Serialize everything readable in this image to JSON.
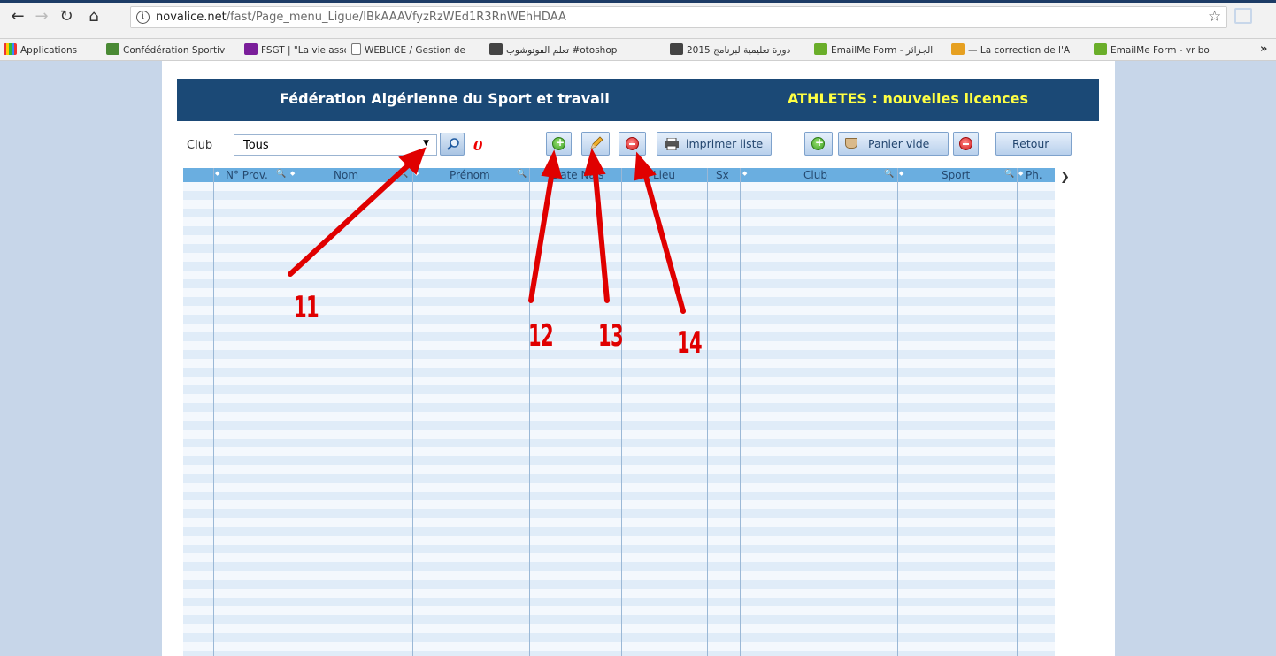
{
  "browser": {
    "url_main": "novalice.net",
    "url_path": "/fast/Page_menu_Ligue/IBkAAAVfyzRzWEd1R3RnWEhHDAA",
    "bookmarks": [
      "Applications",
      "Confédération Sportiv",
      "FSGT | \"La vie associat",
      "WEBLICE / Gestion de",
      "تعلم الفوتوشوب #otoshop",
      "دورة تعليمية لبرنامج 2015",
      "EmailMe Form - الجزائر",
      "— La correction de l'A",
      "EmailMe Form - vr bo"
    ],
    "more": "»"
  },
  "header": {
    "title": "Fédération Algérienne du Sport et travail",
    "subtitle": "ATHLETES : nouvelles licences"
  },
  "filter": {
    "club_label": "Club",
    "club_value": "Tous",
    "count": "0"
  },
  "toolbar": {
    "print_label": "imprimer liste",
    "basket_label": "Panier vide",
    "back_label": "Retour"
  },
  "grid": {
    "columns": [
      "N° Prov.",
      "Nom",
      "Prénom",
      "Date Nais",
      "Lieu",
      "Sx",
      "Club",
      "Sport",
      "Ph."
    ]
  },
  "annotations": [
    "11",
    "12",
    "13",
    "14"
  ],
  "colors": {
    "banner": "#1b4976",
    "banner_subtitle": "#ffff44",
    "grid_header": "#6aaee0",
    "annotation": "#e00000"
  }
}
